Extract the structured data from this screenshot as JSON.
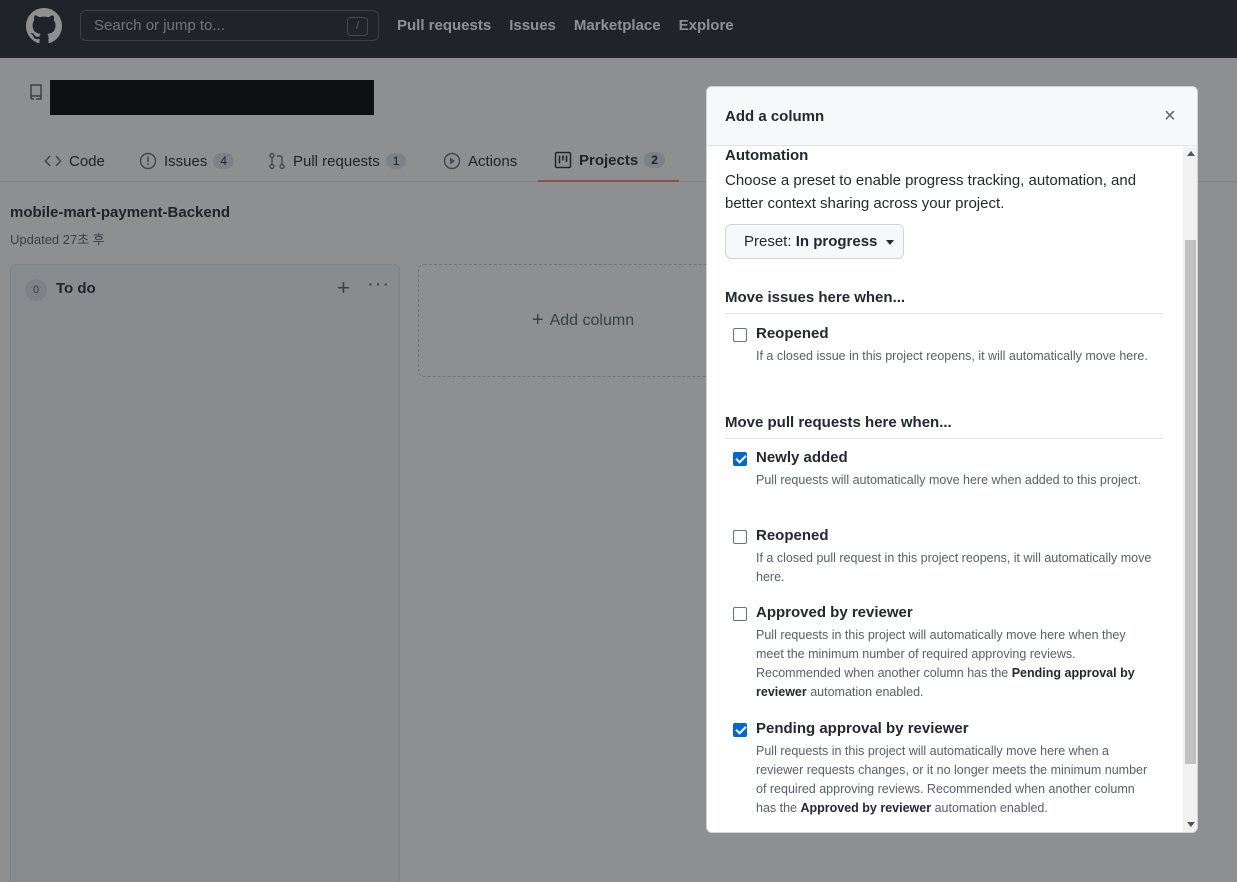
{
  "header": {
    "search_placeholder": "Search or jump to...",
    "search_key": "/",
    "nav": [
      "Pull requests",
      "Issues",
      "Marketplace",
      "Explore"
    ]
  },
  "tabs": [
    {
      "label": "Code",
      "count": null
    },
    {
      "label": "Issues",
      "count": "4"
    },
    {
      "label": "Pull requests",
      "count": "1"
    },
    {
      "label": "Actions",
      "count": null
    },
    {
      "label": "Projects",
      "count": "2"
    }
  ],
  "project": {
    "title": "mobile-mart-payment-Backend",
    "updated": "Updated 27초 후"
  },
  "column": {
    "count": "0",
    "title": "To do",
    "plus": "+",
    "more": "···"
  },
  "add_column": {
    "label": "Add column"
  },
  "modal": {
    "title": "Add a column",
    "close": "×",
    "automation_title": "Automation",
    "automation_desc": "Choose a preset to enable progress tracking, automation, and better context sharing across your project.",
    "preset_label": "Preset:",
    "preset_value": "In progress",
    "issues_heading": "Move issues here when...",
    "issue_options": [
      {
        "label": "Reopened",
        "desc": "If a closed issue in this project reopens, it will automatically move here.",
        "checked": false
      }
    ],
    "prs_heading": "Move pull requests here when...",
    "pr_options": [
      {
        "label": "Newly added",
        "desc": "Pull requests will automatically move here when added to this project.",
        "checked": true
      },
      {
        "label": "Reopened",
        "desc": "If a closed pull request in this project reopens, it will automatically move here.",
        "checked": false
      },
      {
        "label": "Approved by reviewer",
        "desc_pre": "Pull requests in this project will automatically move here when they meet the minimum number of required approving reviews. Recommended when another column has the ",
        "desc_bold": "Pending approval by reviewer",
        "desc_post": " automation enabled.",
        "checked": false
      },
      {
        "label": "Pending approval by reviewer",
        "desc_pre": "Pull requests in this project will automatically move here when a reviewer requests changes, or it no longer meets the minimum number of required approving reviews. Recommended when another column has the ",
        "desc_bold": "Approved by reviewer",
        "desc_post": " automation enabled.",
        "checked": true
      }
    ]
  }
}
